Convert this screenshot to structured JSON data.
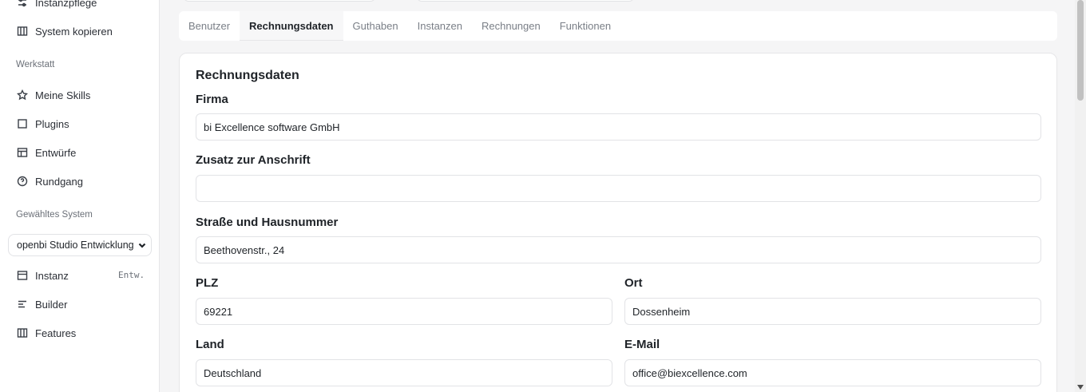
{
  "sidebar": {
    "items_top": [
      {
        "label": "Instanzpflege",
        "icon": "sliders-icon"
      },
      {
        "label": "System kopieren",
        "icon": "columns-icon"
      }
    ],
    "section_werkstatt": "Werkstatt",
    "items_werkstatt": [
      {
        "label": "Meine Skills",
        "icon": "star-icon"
      },
      {
        "label": "Plugins",
        "icon": "square-icon"
      },
      {
        "label": "Entwürfe",
        "icon": "layout-icon"
      },
      {
        "label": "Rundgang",
        "icon": "help-circle-icon"
      }
    ],
    "section_system": "Gewähltes System",
    "selected_system": "openbi Studio Entwicklung",
    "items_system": [
      {
        "label": "Instanz",
        "icon": "layout-icon",
        "badge": "Entw."
      },
      {
        "label": "Builder",
        "icon": "align-left-icon"
      },
      {
        "label": "Features",
        "icon": "columns-icon"
      }
    ]
  },
  "tabs": [
    {
      "label": "Benutzer",
      "active": false
    },
    {
      "label": "Rechnungsdaten",
      "active": true
    },
    {
      "label": "Guthaben",
      "active": false
    },
    {
      "label": "Instanzen",
      "active": false
    },
    {
      "label": "Rechnungen",
      "active": false
    },
    {
      "label": "Funktionen",
      "active": false
    }
  ],
  "form": {
    "title": "Rechnungsdaten",
    "firma_label": "Firma",
    "firma_value": "bi Excellence software GmbH",
    "zusatz_label": "Zusatz zur Anschrift",
    "zusatz_value": "",
    "strasse_label": "Straße und Hausnummer",
    "strasse_value": "Beethovenstr., 24",
    "plz_label": "PLZ",
    "plz_value": "69221",
    "ort_label": "Ort",
    "ort_value": "Dossenheim",
    "land_label": "Land",
    "land_value": "Deutschland",
    "email_label": "E-Mail",
    "email_value": "office@biexcellence.com"
  }
}
